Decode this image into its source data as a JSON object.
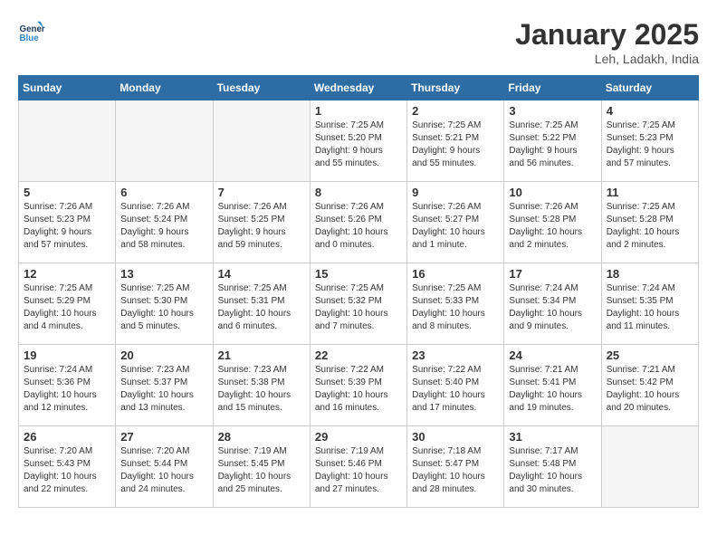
{
  "header": {
    "logo_line1": "General",
    "logo_line2": "Blue",
    "title": "January 2025",
    "subtitle": "Leh, Ladakh, India"
  },
  "weekdays": [
    "Sunday",
    "Monday",
    "Tuesday",
    "Wednesday",
    "Thursday",
    "Friday",
    "Saturday"
  ],
  "weeks": [
    [
      {
        "day": "",
        "info": ""
      },
      {
        "day": "",
        "info": ""
      },
      {
        "day": "",
        "info": ""
      },
      {
        "day": "1",
        "info": "Sunrise: 7:25 AM\nSunset: 5:20 PM\nDaylight: 9 hours\nand 55 minutes."
      },
      {
        "day": "2",
        "info": "Sunrise: 7:25 AM\nSunset: 5:21 PM\nDaylight: 9 hours\nand 55 minutes."
      },
      {
        "day": "3",
        "info": "Sunrise: 7:25 AM\nSunset: 5:22 PM\nDaylight: 9 hours\nand 56 minutes."
      },
      {
        "day": "4",
        "info": "Sunrise: 7:25 AM\nSunset: 5:23 PM\nDaylight: 9 hours\nand 57 minutes."
      }
    ],
    [
      {
        "day": "5",
        "info": "Sunrise: 7:26 AM\nSunset: 5:23 PM\nDaylight: 9 hours\nand 57 minutes."
      },
      {
        "day": "6",
        "info": "Sunrise: 7:26 AM\nSunset: 5:24 PM\nDaylight: 9 hours\nand 58 minutes."
      },
      {
        "day": "7",
        "info": "Sunrise: 7:26 AM\nSunset: 5:25 PM\nDaylight: 9 hours\nand 59 minutes."
      },
      {
        "day": "8",
        "info": "Sunrise: 7:26 AM\nSunset: 5:26 PM\nDaylight: 10 hours\nand 0 minutes."
      },
      {
        "day": "9",
        "info": "Sunrise: 7:26 AM\nSunset: 5:27 PM\nDaylight: 10 hours\nand 1 minute."
      },
      {
        "day": "10",
        "info": "Sunrise: 7:26 AM\nSunset: 5:28 PM\nDaylight: 10 hours\nand 2 minutes."
      },
      {
        "day": "11",
        "info": "Sunrise: 7:25 AM\nSunset: 5:28 PM\nDaylight: 10 hours\nand 2 minutes."
      }
    ],
    [
      {
        "day": "12",
        "info": "Sunrise: 7:25 AM\nSunset: 5:29 PM\nDaylight: 10 hours\nand 4 minutes."
      },
      {
        "day": "13",
        "info": "Sunrise: 7:25 AM\nSunset: 5:30 PM\nDaylight: 10 hours\nand 5 minutes."
      },
      {
        "day": "14",
        "info": "Sunrise: 7:25 AM\nSunset: 5:31 PM\nDaylight: 10 hours\nand 6 minutes."
      },
      {
        "day": "15",
        "info": "Sunrise: 7:25 AM\nSunset: 5:32 PM\nDaylight: 10 hours\nand 7 minutes."
      },
      {
        "day": "16",
        "info": "Sunrise: 7:25 AM\nSunset: 5:33 PM\nDaylight: 10 hours\nand 8 minutes."
      },
      {
        "day": "17",
        "info": "Sunrise: 7:24 AM\nSunset: 5:34 PM\nDaylight: 10 hours\nand 9 minutes."
      },
      {
        "day": "18",
        "info": "Sunrise: 7:24 AM\nSunset: 5:35 PM\nDaylight: 10 hours\nand 11 minutes."
      }
    ],
    [
      {
        "day": "19",
        "info": "Sunrise: 7:24 AM\nSunset: 5:36 PM\nDaylight: 10 hours\nand 12 minutes."
      },
      {
        "day": "20",
        "info": "Sunrise: 7:23 AM\nSunset: 5:37 PM\nDaylight: 10 hours\nand 13 minutes."
      },
      {
        "day": "21",
        "info": "Sunrise: 7:23 AM\nSunset: 5:38 PM\nDaylight: 10 hours\nand 15 minutes."
      },
      {
        "day": "22",
        "info": "Sunrise: 7:22 AM\nSunset: 5:39 PM\nDaylight: 10 hours\nand 16 minutes."
      },
      {
        "day": "23",
        "info": "Sunrise: 7:22 AM\nSunset: 5:40 PM\nDaylight: 10 hours\nand 17 minutes."
      },
      {
        "day": "24",
        "info": "Sunrise: 7:21 AM\nSunset: 5:41 PM\nDaylight: 10 hours\nand 19 minutes."
      },
      {
        "day": "25",
        "info": "Sunrise: 7:21 AM\nSunset: 5:42 PM\nDaylight: 10 hours\nand 20 minutes."
      }
    ],
    [
      {
        "day": "26",
        "info": "Sunrise: 7:20 AM\nSunset: 5:43 PM\nDaylight: 10 hours\nand 22 minutes."
      },
      {
        "day": "27",
        "info": "Sunrise: 7:20 AM\nSunset: 5:44 PM\nDaylight: 10 hours\nand 24 minutes."
      },
      {
        "day": "28",
        "info": "Sunrise: 7:19 AM\nSunset: 5:45 PM\nDaylight: 10 hours\nand 25 minutes."
      },
      {
        "day": "29",
        "info": "Sunrise: 7:19 AM\nSunset: 5:46 PM\nDaylight: 10 hours\nand 27 minutes."
      },
      {
        "day": "30",
        "info": "Sunrise: 7:18 AM\nSunset: 5:47 PM\nDaylight: 10 hours\nand 28 minutes."
      },
      {
        "day": "31",
        "info": "Sunrise: 7:17 AM\nSunset: 5:48 PM\nDaylight: 10 hours\nand 30 minutes."
      },
      {
        "day": "",
        "info": ""
      }
    ]
  ]
}
